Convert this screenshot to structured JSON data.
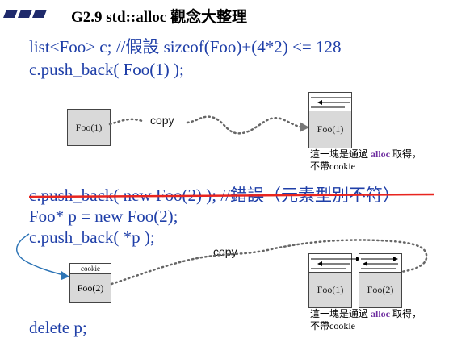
{
  "slide": {
    "title": "G2.9 std::alloc 觀念大整理"
  },
  "code_top": {
    "line1": "list<Foo> c;   //假設 sizeof(Foo)+(4*2) <= 128",
    "line2": "c.push_back( Foo(1) );"
  },
  "diagram1": {
    "src_label": "Foo(1)",
    "copy_label": "copy",
    "dst_label": "Foo(1)",
    "note_line1_a": "這一塊是通過 ",
    "note_line1_alloc": "alloc",
    "note_line1_b": " 取得，",
    "note_line2": "不帶cookie"
  },
  "code_mid": {
    "strike_line": "c.push_back( new Foo(2) );  //錯誤（元素型別不符）",
    "line1": "Foo* p = new Foo(2);",
    "line2": "c.push_back( *p );"
  },
  "diagram2": {
    "cookie_label": "cookie",
    "src_label": "Foo(2)",
    "copy_label": "copy",
    "node1_label": "Foo(1)",
    "node2_label": "Foo(2)",
    "note_line1_a": "這一塊是通過 ",
    "note_line1_alloc": "alloc",
    "note_line1_b": " 取得，",
    "note_line2": "不帶cookie"
  },
  "code_bottom": {
    "line1": "delete p;"
  },
  "colors": {
    "code": "#1f3fa8",
    "strike": "#e8251f",
    "box_fill": "#d9d9d9",
    "alloc": "#7030a0",
    "arrow_blue": "#2e75b6"
  }
}
